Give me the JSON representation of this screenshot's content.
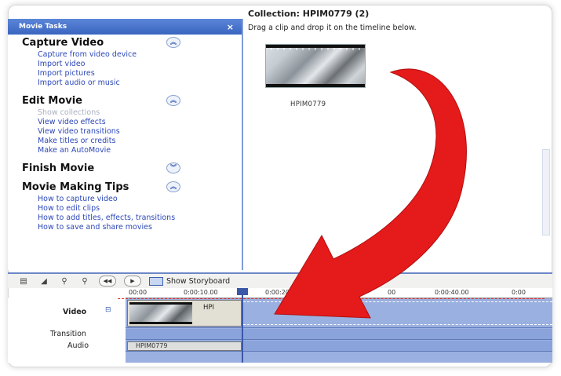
{
  "task_pane": {
    "header": "Movie Tasks",
    "close_glyph": "×",
    "sections": [
      {
        "number": "",
        "title": "Capture Video",
        "chevron": "up",
        "links": [
          {
            "label": "Capture from video device",
            "enabled": true
          },
          {
            "label": "Import video",
            "enabled": true
          },
          {
            "label": "Import pictures",
            "enabled": true
          },
          {
            "label": "Import audio or music",
            "enabled": true
          }
        ]
      },
      {
        "number": "",
        "title": "Edit Movie",
        "chevron": "up",
        "links": [
          {
            "label": "Show collections",
            "enabled": false
          },
          {
            "label": "View video effects",
            "enabled": true
          },
          {
            "label": "View video transitions",
            "enabled": true
          },
          {
            "label": "Make titles or credits",
            "enabled": true
          },
          {
            "label": "Make an AutoMovie",
            "enabled": true
          }
        ]
      },
      {
        "number": "",
        "title": "Finish Movie",
        "chevron": "down",
        "links": []
      },
      {
        "number": "",
        "title": "Movie Making Tips",
        "chevron": "up",
        "links": [
          {
            "label": "How to capture video",
            "enabled": true
          },
          {
            "label": "How to edit clips",
            "enabled": true
          },
          {
            "label": "How to add titles, effects, transitions",
            "enabled": true
          },
          {
            "label": "How to save and share movies",
            "enabled": true
          }
        ]
      }
    ]
  },
  "collection": {
    "title": "Collection: HPIM0779 (2)",
    "hint": "Drag a clip and drop it on the timeline below.",
    "clip_name": "HPIM0779"
  },
  "timeline": {
    "show_storyboard": "Show Storyboard",
    "ruler_labels": [
      "00:00",
      "0:00:10.00",
      "0:00:20",
      "00",
      "0:00:40.00",
      "0:00"
    ],
    "tracks": {
      "video": "Video",
      "transition": "Transition",
      "audio": "Audio"
    },
    "video_clip_name": "HPI",
    "audio_clip_name": "HPIM0779"
  },
  "colors": {
    "accent": "#3a65c0",
    "link": "#2b47b8",
    "arrow": "#e51a1a",
    "track": "#9ab0e0"
  }
}
